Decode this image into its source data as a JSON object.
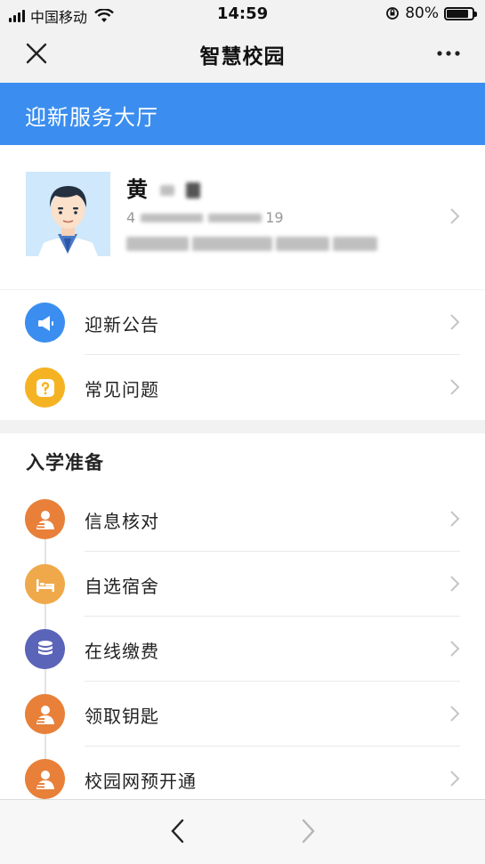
{
  "status_bar": {
    "carrier": "中国移动",
    "time": "14:59",
    "battery": "80%",
    "battery_level": 0.8
  },
  "nav": {
    "title": "智慧校园",
    "close_icon": "close-icon",
    "more_icon": "more-dots-icon"
  },
  "banner": {
    "title": "迎新服务大厅"
  },
  "profile": {
    "name_visible": "黄",
    "id_prefix": "4",
    "id_suffix": "19"
  },
  "quick_links": [
    {
      "label": "迎新公告",
      "icon": "megaphone-icon",
      "color": "#3b8eef"
    },
    {
      "label": "常见问题",
      "icon": "question-icon",
      "color": "#f5b324"
    }
  ],
  "enrollment": {
    "title": "入学准备",
    "items": [
      {
        "label": "信息核对",
        "icon": "person-doc-icon",
        "color": "#e8803a"
      },
      {
        "label": "自选宿舍",
        "icon": "bed-icon",
        "color": "#f0a94a"
      },
      {
        "label": "在线缴费",
        "icon": "coins-icon",
        "color": "#5a64b8"
      },
      {
        "label": "领取钥匙",
        "icon": "person-doc-icon",
        "color": "#e8803a"
      },
      {
        "label": "校园网预开通",
        "icon": "person-doc-icon",
        "color": "#e8803a"
      }
    ]
  },
  "colors": {
    "accent": "#3b8eef",
    "background": "#f2f2f2"
  }
}
